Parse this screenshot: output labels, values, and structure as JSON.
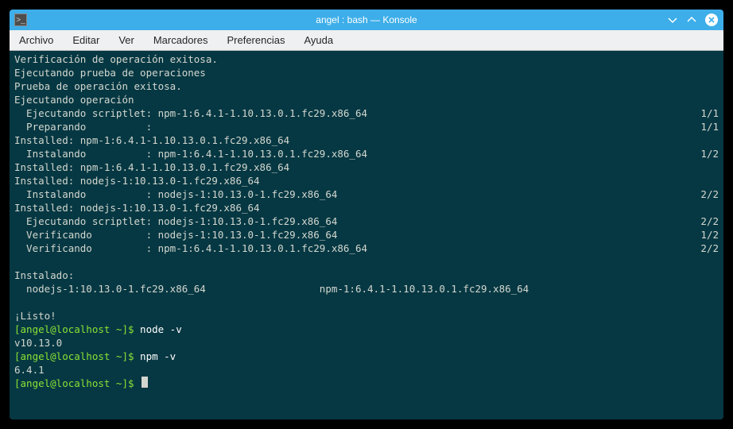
{
  "window": {
    "title": "angel : bash — Konsole",
    "icon_glyph": ">_"
  },
  "menubar": {
    "items": [
      "Archivo",
      "Editar",
      "Ver",
      "Marcadores",
      "Preferencias",
      "Ayuda"
    ]
  },
  "terminal": {
    "lines": [
      {
        "type": "plain",
        "text": "Verificación de operación exitosa."
      },
      {
        "type": "plain",
        "text": "Ejecutando prueba de operaciones"
      },
      {
        "type": "plain",
        "text": "Prueba de operación exitosa."
      },
      {
        "type": "plain",
        "text": "Ejecutando operación"
      },
      {
        "type": "progress",
        "text": "  Ejecutando scriptlet: npm-1:6.4.1-1.10.13.0.1.fc29.x86_64",
        "right": "1/1"
      },
      {
        "type": "progress",
        "text": "  Preparando          :",
        "right": "1/1"
      },
      {
        "type": "plain",
        "text": "Installed: npm-1:6.4.1-1.10.13.0.1.fc29.x86_64"
      },
      {
        "type": "progress",
        "text": "  Instalando          : npm-1:6.4.1-1.10.13.0.1.fc29.x86_64",
        "right": "1/2"
      },
      {
        "type": "plain",
        "text": "Installed: npm-1:6.4.1-1.10.13.0.1.fc29.x86_64"
      },
      {
        "type": "plain",
        "text": "Installed: nodejs-1:10.13.0-1.fc29.x86_64"
      },
      {
        "type": "progress",
        "text": "  Instalando          : nodejs-1:10.13.0-1.fc29.x86_64",
        "right": "2/2"
      },
      {
        "type": "plain",
        "text": "Installed: nodejs-1:10.13.0-1.fc29.x86_64"
      },
      {
        "type": "progress",
        "text": "  Ejecutando scriptlet: nodejs-1:10.13.0-1.fc29.x86_64",
        "right": "2/2"
      },
      {
        "type": "progress",
        "text": "  Verificando         : nodejs-1:10.13.0-1.fc29.x86_64",
        "right": "1/2"
      },
      {
        "type": "progress",
        "text": "  Verificando         : npm-1:6.4.1-1.10.13.0.1.fc29.x86_64",
        "right": "2/2"
      },
      {
        "type": "blank",
        "text": ""
      },
      {
        "type": "plain",
        "text": "Instalado:"
      },
      {
        "type": "plain",
        "text": "  nodejs-1:10.13.0-1.fc29.x86_64                   npm-1:6.4.1-1.10.13.0.1.fc29.x86_64"
      },
      {
        "type": "blank",
        "text": ""
      },
      {
        "type": "plain",
        "text": "¡Listo!"
      },
      {
        "type": "prompt",
        "prompt": "[angel@localhost ~]$ ",
        "cmd": "node -v"
      },
      {
        "type": "plain",
        "text": "v10.13.0"
      },
      {
        "type": "prompt",
        "prompt": "[angel@localhost ~]$ ",
        "cmd": "npm -v"
      },
      {
        "type": "plain",
        "text": "6.4.1"
      },
      {
        "type": "prompt_cursor",
        "prompt": "[angel@localhost ~]$ "
      }
    ]
  }
}
